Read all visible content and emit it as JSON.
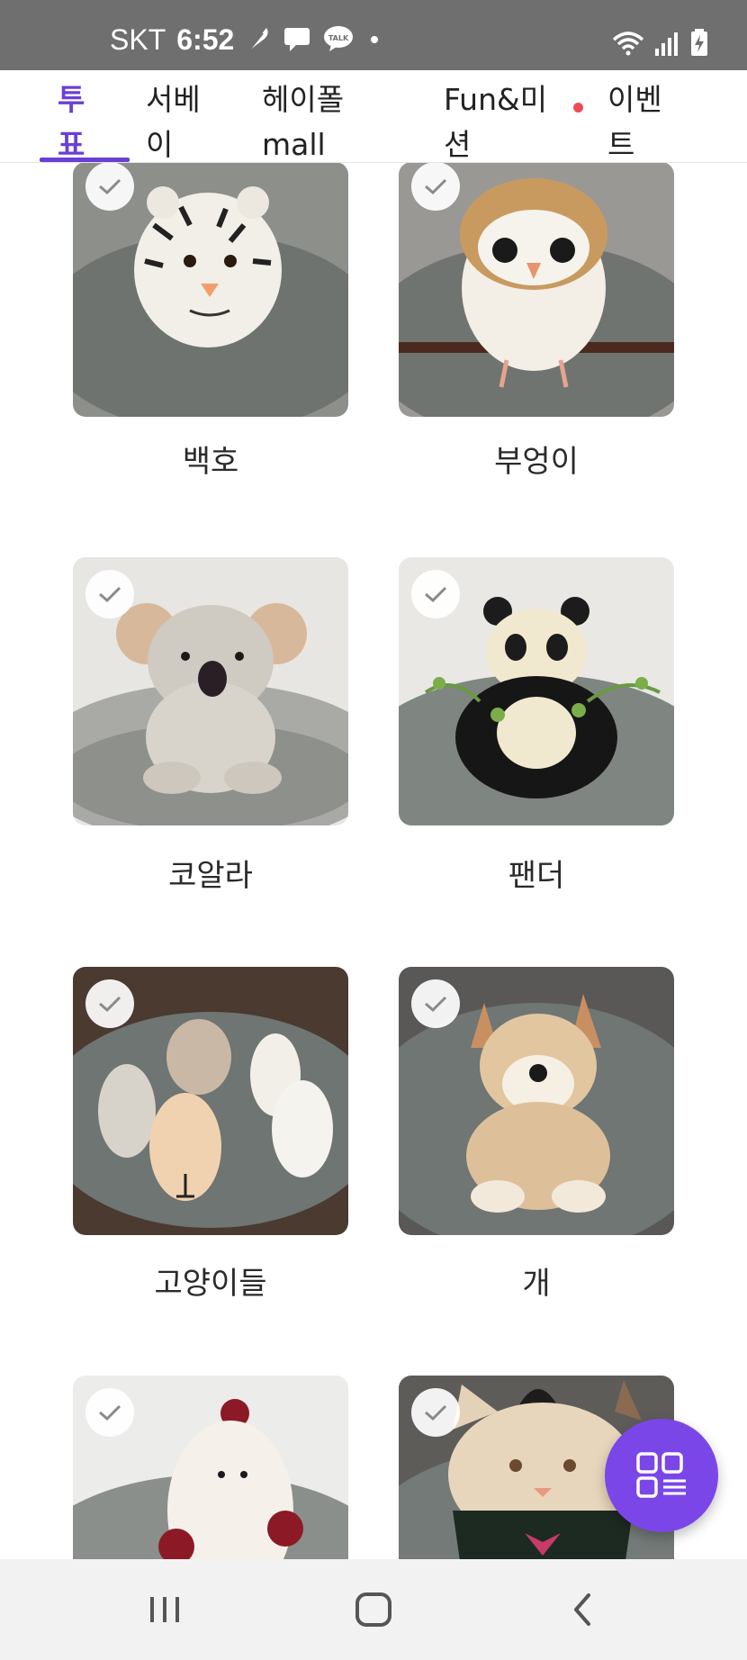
{
  "status_bar": {
    "carrier": "SKT",
    "time": "6:52",
    "icons": [
      "feather-icon",
      "chat-bubble-icon",
      "kakaotalk-icon",
      "dot-icon",
      "wifi-icon",
      "signal-icon",
      "battery-charging-icon"
    ],
    "talk_badge": "TALK"
  },
  "tabs": [
    {
      "label": "투\n표",
      "active": true
    },
    {
      "label": "서베\n이"
    },
    {
      "label": "헤이폴\nmall"
    },
    {
      "label": "Fun&미\n션",
      "has_new_dot": true
    },
    {
      "label": "이벤\n트"
    }
  ],
  "items": [
    {
      "label": "백호"
    },
    {
      "label": "부엉이"
    },
    {
      "label": "코알라"
    },
    {
      "label": "팬더"
    },
    {
      "label": "고양이들"
    },
    {
      "label": "개"
    },
    {
      "label": ""
    },
    {
      "label": ""
    }
  ],
  "fab": {
    "icon": "grid-menu-icon"
  },
  "nav": {
    "icons": [
      "recent-apps-icon",
      "home-icon",
      "back-icon"
    ]
  },
  "colors": {
    "accent": "#6a3fd6",
    "fab": "#7a46e8",
    "dot": "#ee4d55"
  }
}
